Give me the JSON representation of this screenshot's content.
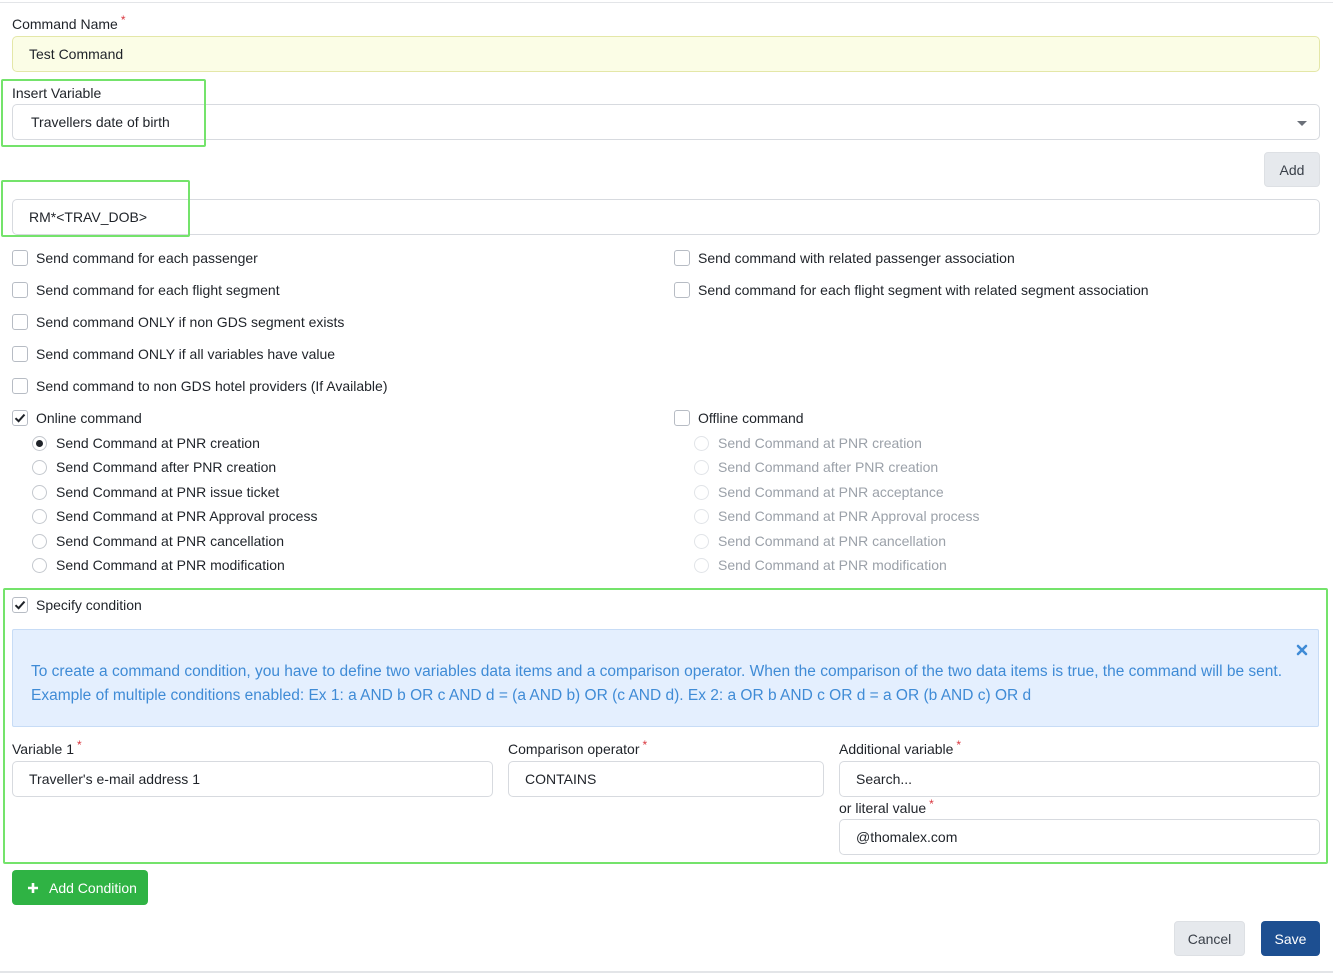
{
  "form": {
    "command_name_label": "Command Name",
    "command_name_value": "Test Command",
    "insert_variable_label": "Insert Variable",
    "insert_variable_value": "Travellers date of birth",
    "add_label": "Add",
    "command_text_value": "RM*<TRAV_DOB>"
  },
  "options_left": [
    {
      "label": "Send command for each passenger",
      "checked": false
    },
    {
      "label": "Send command for each flight segment",
      "checked": false
    },
    {
      "label": "Send command ONLY if non GDS segment exists",
      "checked": false
    },
    {
      "label": "Send command ONLY if all variables have value",
      "checked": false
    },
    {
      "label": "Send command to non GDS hotel providers (If Available)",
      "checked": false
    }
  ],
  "options_right": [
    {
      "label": "Send command with related passenger association",
      "checked": false
    },
    {
      "label": "Send command for each flight segment with related segment association",
      "checked": false
    }
  ],
  "online": {
    "label": "Online command",
    "checked": true,
    "radios": [
      {
        "label": "Send Command at PNR creation",
        "selected": true
      },
      {
        "label": "Send Command after PNR creation",
        "selected": false
      },
      {
        "label": "Send Command at PNR issue ticket",
        "selected": false
      },
      {
        "label": "Send Command at PNR Approval process",
        "selected": false
      },
      {
        "label": "Send Command at PNR cancellation",
        "selected": false
      },
      {
        "label": "Send Command at PNR modification",
        "selected": false
      }
    ]
  },
  "offline": {
    "label": "Offline command",
    "checked": false,
    "radios": [
      {
        "label": "Send Command at PNR creation"
      },
      {
        "label": "Send Command after PNR creation"
      },
      {
        "label": "Send Command at PNR acceptance"
      },
      {
        "label": "Send Command at PNR Approval process"
      },
      {
        "label": "Send Command at PNR cancellation"
      },
      {
        "label": "Send Command at PNR modification"
      }
    ]
  },
  "condition": {
    "label": "Specify condition",
    "checked": true,
    "info_text": "To create a command condition, you have to define two variables data items and a comparison operator. When the comparison of the two data items is true, the command will be sent. Example of multiple conditions enabled: Ex 1: a AND b OR c AND d = (a AND b) OR (c AND d). Ex 2: a OR b AND c OR d = a OR (b AND c) OR d",
    "variable1_label": "Variable 1",
    "variable1_value": "Traveller's e-mail address 1",
    "operator_label": "Comparison operator",
    "operator_value": "CONTAINS",
    "additional_label": "Additional variable",
    "additional_placeholder": "Search...",
    "literal_label": "or literal value",
    "literal_value": "@thomalex.com",
    "add_condition_label": "Add Condition"
  },
  "footer": {
    "cancel_label": "Cancel",
    "save_label": "Save"
  },
  "colors": {
    "primary": "#1d4f91",
    "success": "#2fb344",
    "highlight": "#74e36b",
    "info_text": "#3f8bd6",
    "info_bg": "#e4effe",
    "required": "#d9363e"
  }
}
